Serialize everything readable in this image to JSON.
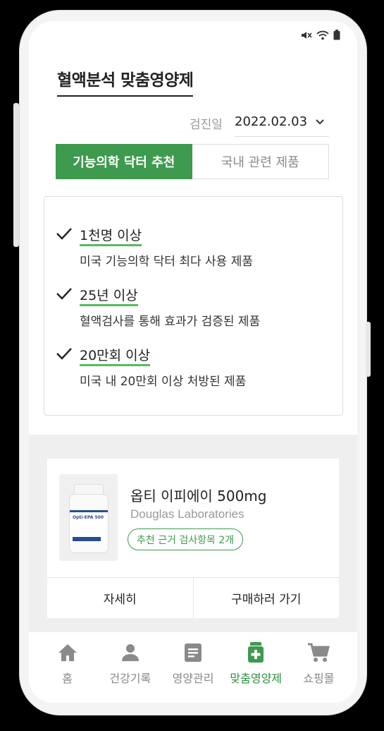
{
  "header": {
    "title": "혈액분석 맞춤영양제"
  },
  "filter": {
    "date_label": "검진일",
    "date_value": "2022.02.03"
  },
  "segments": [
    {
      "label": "기능의학 닥터 추천",
      "active": true
    },
    {
      "label": "국내 관련 제품",
      "active": false
    }
  ],
  "features": [
    {
      "title": "1천명 이상",
      "description": "미국 기능의학 닥터 최다 사용 제품"
    },
    {
      "title": "25년 이상",
      "description": "혈액검사를 통해 효과가 검증된 제품"
    },
    {
      "title": "20만회 이상",
      "description": "미국 내 20만회 이상 처방된 제품"
    }
  ],
  "product": {
    "name": "옵티 이피에이 500mg",
    "brand": "Douglas Laboratories",
    "badge": "추천 근거 검사항목 2개",
    "image_text": "Opti-EPA 500",
    "actions": {
      "detail": "자세히",
      "buy": "구매하러 가기"
    }
  },
  "tabbar": [
    {
      "label": "홈",
      "icon": "home-icon",
      "active": false
    },
    {
      "label": "건강기록",
      "icon": "person-icon",
      "active": false
    },
    {
      "label": "영양관리",
      "icon": "document-icon",
      "active": false
    },
    {
      "label": "맞춤영양제",
      "icon": "medicine-bottle-icon",
      "active": true
    },
    {
      "label": "쇼핑몰",
      "icon": "cart-icon",
      "active": false
    }
  ],
  "colors": {
    "accent": "#3e9a4e",
    "underline": "#54bb5e",
    "inactive_icon": "#8a8a8a"
  }
}
